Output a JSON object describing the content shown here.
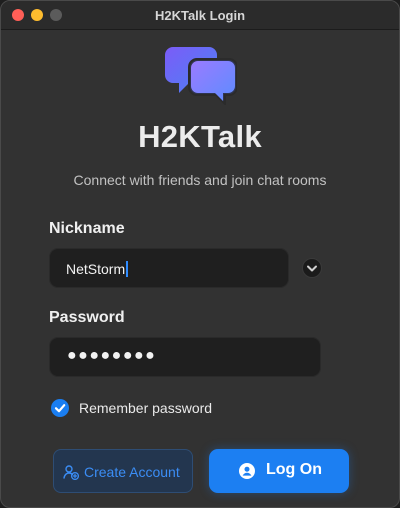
{
  "window": {
    "title": "H2KTalk Login"
  },
  "app": {
    "name": "H2KTalk",
    "tagline": "Connect with friends and join chat rooms",
    "logo_icon": "chat-bubbles-icon"
  },
  "form": {
    "nickname_label": "Nickname",
    "nickname_value": "NetStorm",
    "password_label": "Password",
    "password_masked": "●●●●●●●●",
    "remember_label": "Remember password",
    "remember_checked": true
  },
  "buttons": {
    "create_account": "Create Account",
    "log_on": "Log On"
  },
  "colors": {
    "accent": "#1c7ff2",
    "window_bg": "#323232",
    "field_bg": "#1f1f1f"
  }
}
